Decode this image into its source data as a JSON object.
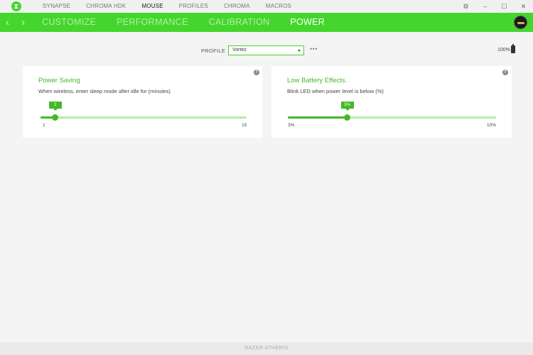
{
  "topnav": {
    "items": [
      "SYNAPSE",
      "CHROMA HDK",
      "MOUSE",
      "PROFILES",
      "CHROMA",
      "MACROS"
    ],
    "active": 2
  },
  "window_controls": {
    "settings": "⚙",
    "minimize": "–",
    "maximize": "☐",
    "close": "✕"
  },
  "subnav": {
    "back": "‹",
    "forward": "›",
    "tabs": [
      "CUSTOMIZE",
      "PERFORMANCE",
      "CALIBRATION",
      "POWER"
    ],
    "active": 3
  },
  "profile": {
    "label": "PROFILE",
    "selected": "Vortez",
    "more": "•••"
  },
  "battery": {
    "percent": "100%",
    "level": 1.0
  },
  "power_saving": {
    "title": "Power Saving",
    "description": "When wireless, enter sleep mode after idle for (minutes)",
    "help": "?",
    "min": 1,
    "max": 15,
    "value": 2,
    "min_label": "1",
    "max_label": "15",
    "value_label": "2"
  },
  "low_battery": {
    "title": "Low Battery Effects.",
    "description": "Blink LED when power level is below (%)",
    "help": "?",
    "min": 3,
    "max": 10,
    "value": 5,
    "min_label": "3%",
    "max_label": "10%",
    "value_label": "5%"
  },
  "footer": {
    "device": "RAZER ATHERIS"
  },
  "colors": {
    "accent": "#44d62c",
    "accent_dark": "#44b82a",
    "track": "#b9eb9f"
  }
}
